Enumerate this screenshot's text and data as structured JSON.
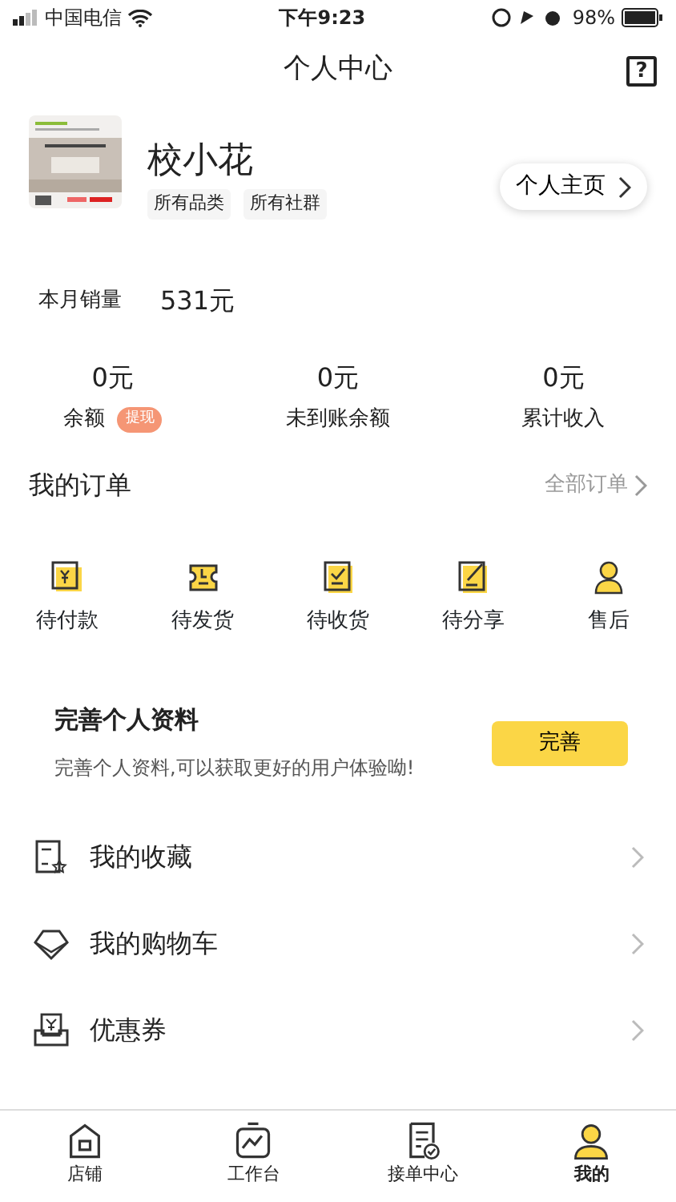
{
  "status_bar": {
    "carrier": "中国电信",
    "time": "下午9:23",
    "battery": "98%"
  },
  "nav": {
    "title": "个人中心",
    "help": "?"
  },
  "profile": {
    "avatar": {
      "kind": "picture"
    },
    "name": "校小花",
    "tags": [
      "所有品类",
      "所有社群"
    ],
    "home_button": "个人主页"
  },
  "sales": {
    "label": "本月销量",
    "value": "531元"
  },
  "stats": [
    {
      "value": "0元",
      "label": "余额",
      "badge": "提现"
    },
    {
      "value": "0元",
      "label": "未到账余额"
    },
    {
      "value": "0元",
      "label": "累计收入"
    }
  ],
  "orders": {
    "title": "我的订单",
    "all_link": "全部订单",
    "items": [
      {
        "kind": "pay",
        "label": "待付款"
      },
      {
        "kind": "ship",
        "label": "待发货"
      },
      {
        "kind": "receive",
        "label": "待收货"
      },
      {
        "kind": "share",
        "label": "待分享"
      },
      {
        "kind": "after",
        "label": "售后"
      }
    ]
  },
  "complete_profile": {
    "title": "完善个人资料",
    "text": "完善个人资料,可以获取更好的用户体验呦!",
    "button": "完善"
  },
  "menu": [
    {
      "kind": "favorites",
      "label": "我的收藏"
    },
    {
      "kind": "cart",
      "label": "我的购物车"
    },
    {
      "kind": "coupon",
      "label": "优惠券"
    }
  ],
  "tab_bar": [
    {
      "kind": "store",
      "label": "店铺",
      "selected": false
    },
    {
      "kind": "workbench",
      "label": "工作台",
      "selected": false
    },
    {
      "kind": "orders",
      "label": "接单中心",
      "selected": false
    },
    {
      "kind": "me",
      "label": "我的",
      "selected": true
    }
  ]
}
